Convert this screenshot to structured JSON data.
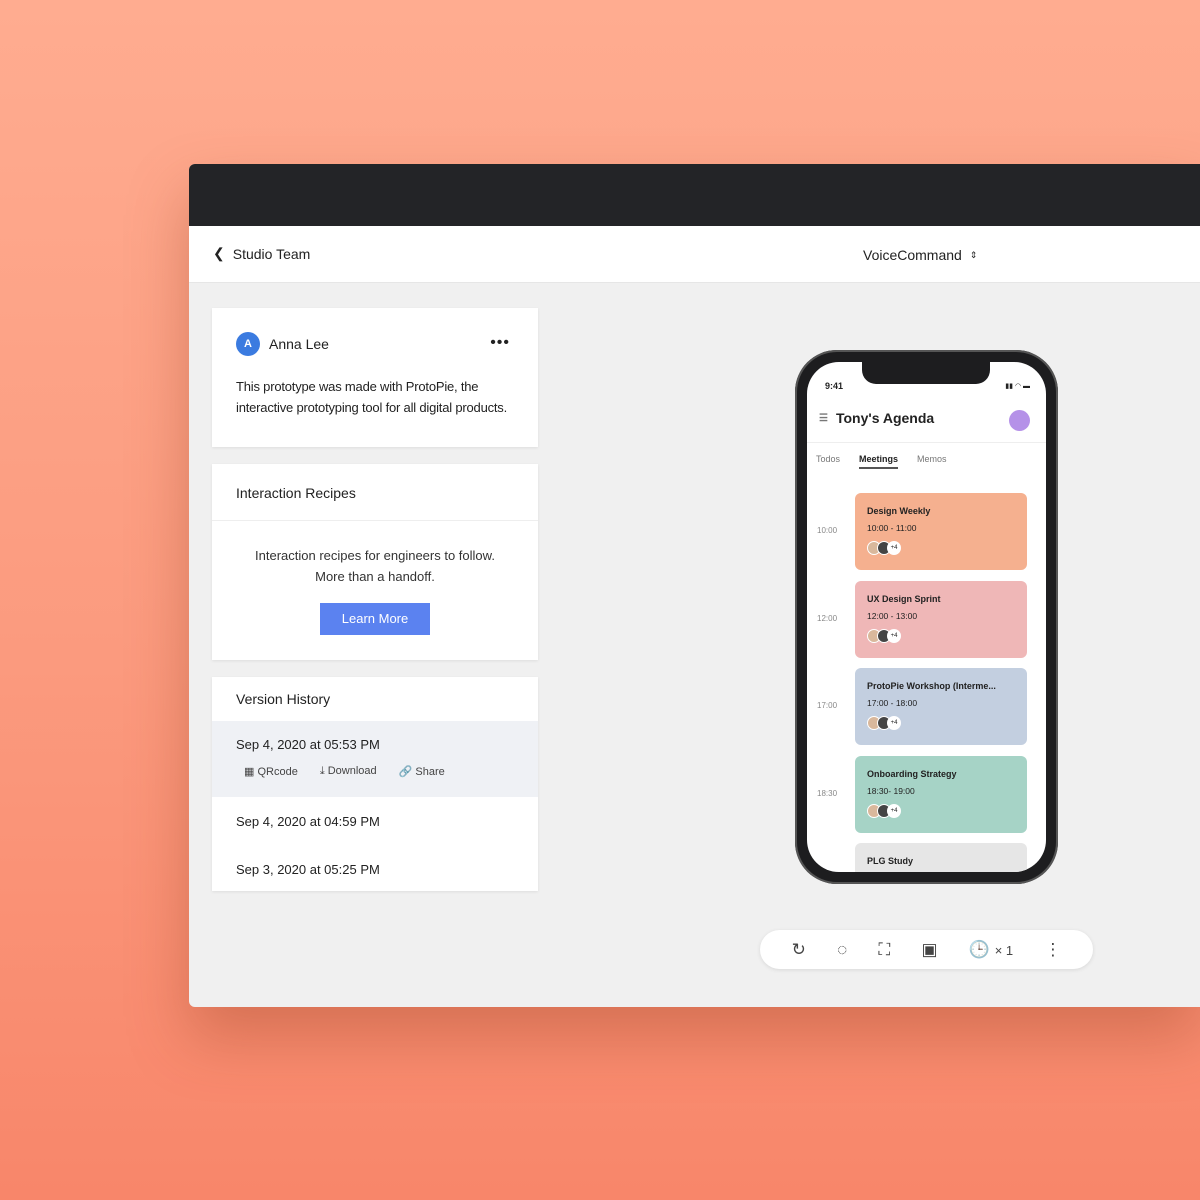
{
  "header": {
    "back_label": "Studio Team",
    "project": "VoiceCommand"
  },
  "comment": {
    "avatar_initial": "A",
    "author": "Anna Lee",
    "text": "This prototype was made with ProtoPie, the interactive prototyping tool for all digital products."
  },
  "recipes": {
    "title": "Interaction Recipes",
    "line1": "Interaction recipes for engineers to follow.",
    "line2": "More than a handoff.",
    "button": "Learn More"
  },
  "versions": {
    "title": "Version History",
    "items": [
      "Sep 4, 2020 at 05:53 PM",
      "Sep 4, 2020 at 04:59 PM",
      "Sep 3, 2020 at 05:25 PM"
    ],
    "actions": [
      "QRcode",
      "Download",
      "Share"
    ]
  },
  "phone": {
    "time": "9:41",
    "title": "Tony's Agenda",
    "tabs": [
      "Todos",
      "Meetings",
      "Memos"
    ],
    "events": [
      {
        "hour": "10:00",
        "title": "Design Weekly",
        "range": "10:00 - 11:00",
        "more": "+4",
        "color": "#f5b08f"
      },
      {
        "hour": "12:00",
        "title": "UX Design Sprint",
        "range": "12:00 - 13:00",
        "more": "+4",
        "color": "#efb7b7"
      },
      {
        "hour": "17:00",
        "title": "ProtoPie Workshop (Interme...",
        "range": "17:00 - 18:00",
        "more": "+4",
        "color": "#c3cfe0"
      },
      {
        "hour": "18:30",
        "title": "Onboarding Strategy",
        "range": "18:30- 19:00",
        "more": "+4",
        "color": "#a6d3c6"
      },
      {
        "hour": "",
        "title": "PLG Study",
        "range": "",
        "more": "",
        "color": "#e6e6e6"
      }
    ]
  },
  "toolbar": {
    "speed": "× 1"
  }
}
